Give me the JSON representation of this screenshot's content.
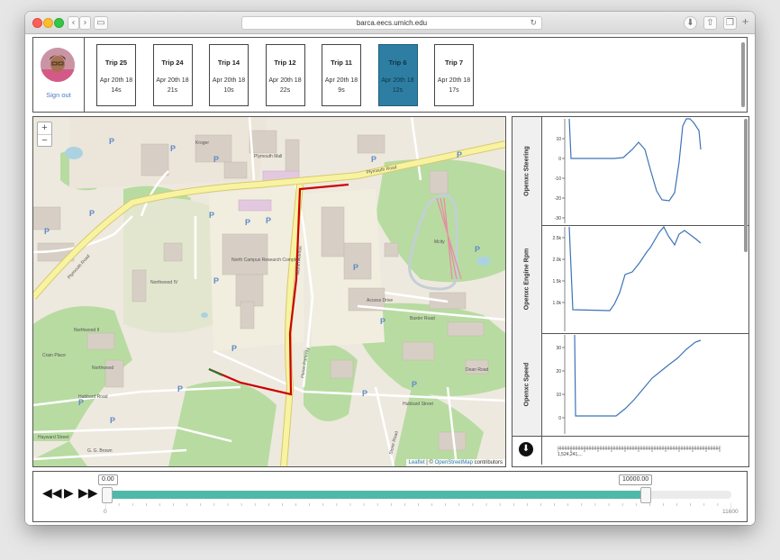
{
  "browser": {
    "url": "barca.eecs.umich.edu"
  },
  "user": {
    "sign_out": "Sign out"
  },
  "trips": [
    {
      "name": "Trip 25",
      "date": "Apr 20th 18",
      "duration": "14s",
      "active": false
    },
    {
      "name": "Trip 24",
      "date": "Apr 20th 18",
      "duration": "21s",
      "active": false
    },
    {
      "name": "Trip 14",
      "date": "Apr 20th 18",
      "duration": "10s",
      "active": false
    },
    {
      "name": "Trip 12",
      "date": "Apr 20th 18",
      "duration": "22s",
      "active": false
    },
    {
      "name": "Trip 11",
      "date": "Apr 20th 18",
      "duration": "9s",
      "active": false
    },
    {
      "name": "Trip 6",
      "date": "Apr 20th 18",
      "duration": "12s",
      "active": true
    },
    {
      "name": "Trip 7",
      "date": "Apr 20th 18",
      "duration": "17s",
      "active": false
    }
  ],
  "map": {
    "zoom_in": "+",
    "zoom_out": "−",
    "attribution": {
      "leaflet": "Leaflet",
      "sep": " | © ",
      "osm": "OpenStreetMap",
      "contributors": " contributors"
    },
    "labels": {
      "plymouth_road_w": "Plymouth Road",
      "plymouth_road_e": "Plymouth Road",
      "hubbard_road": "Hubbard Road",
      "hubbard_street": "Hubbard Street",
      "huron_parkway": "Huron Parkway",
      "murfin": "Murfin Avenue",
      "access_drive": "Access Drive",
      "baxter_road": "Baxter Road",
      "north_campus": "North Campus Research Complex",
      "northwood_iv": "Northwood IV",
      "northwood_ii": "Northwood II",
      "northwood": "Northwood",
      "mcity": "Mcity",
      "kroger": "Kroger",
      "plymouth_mall": "Plymouth Mall",
      "hayward_street": "Hayward Street",
      "gg_brown": "G. G. Brown",
      "dean_road": "Dean Road",
      "stone_road": "Stone Road",
      "crain_place": "Crain Place"
    }
  },
  "charts": [
    {
      "label": "Openxc Steering",
      "y_ticks": [
        "10",
        "0",
        "-10",
        "-20",
        "-30"
      ]
    },
    {
      "label": "Openxc Engine Rpm",
      "y_ticks": [
        "2.5k",
        "2.0k",
        "1.5k",
        "1.0k"
      ]
    },
    {
      "label": "Openxc Speed",
      "y_ticks": [
        "30",
        "20",
        "10",
        "0"
      ]
    }
  ],
  "chart_axis_label": "1,524,241,...",
  "download_icon": "download-icon",
  "player": {
    "start_value": "0.00",
    "end_value": "10000.00",
    "min_label": "0",
    "max_label": "11600",
    "progress": 0.862
  },
  "colors": {
    "accent": "#4fb9a9",
    "active_trip": "#2e7ea3",
    "route": "#cc0000"
  }
}
